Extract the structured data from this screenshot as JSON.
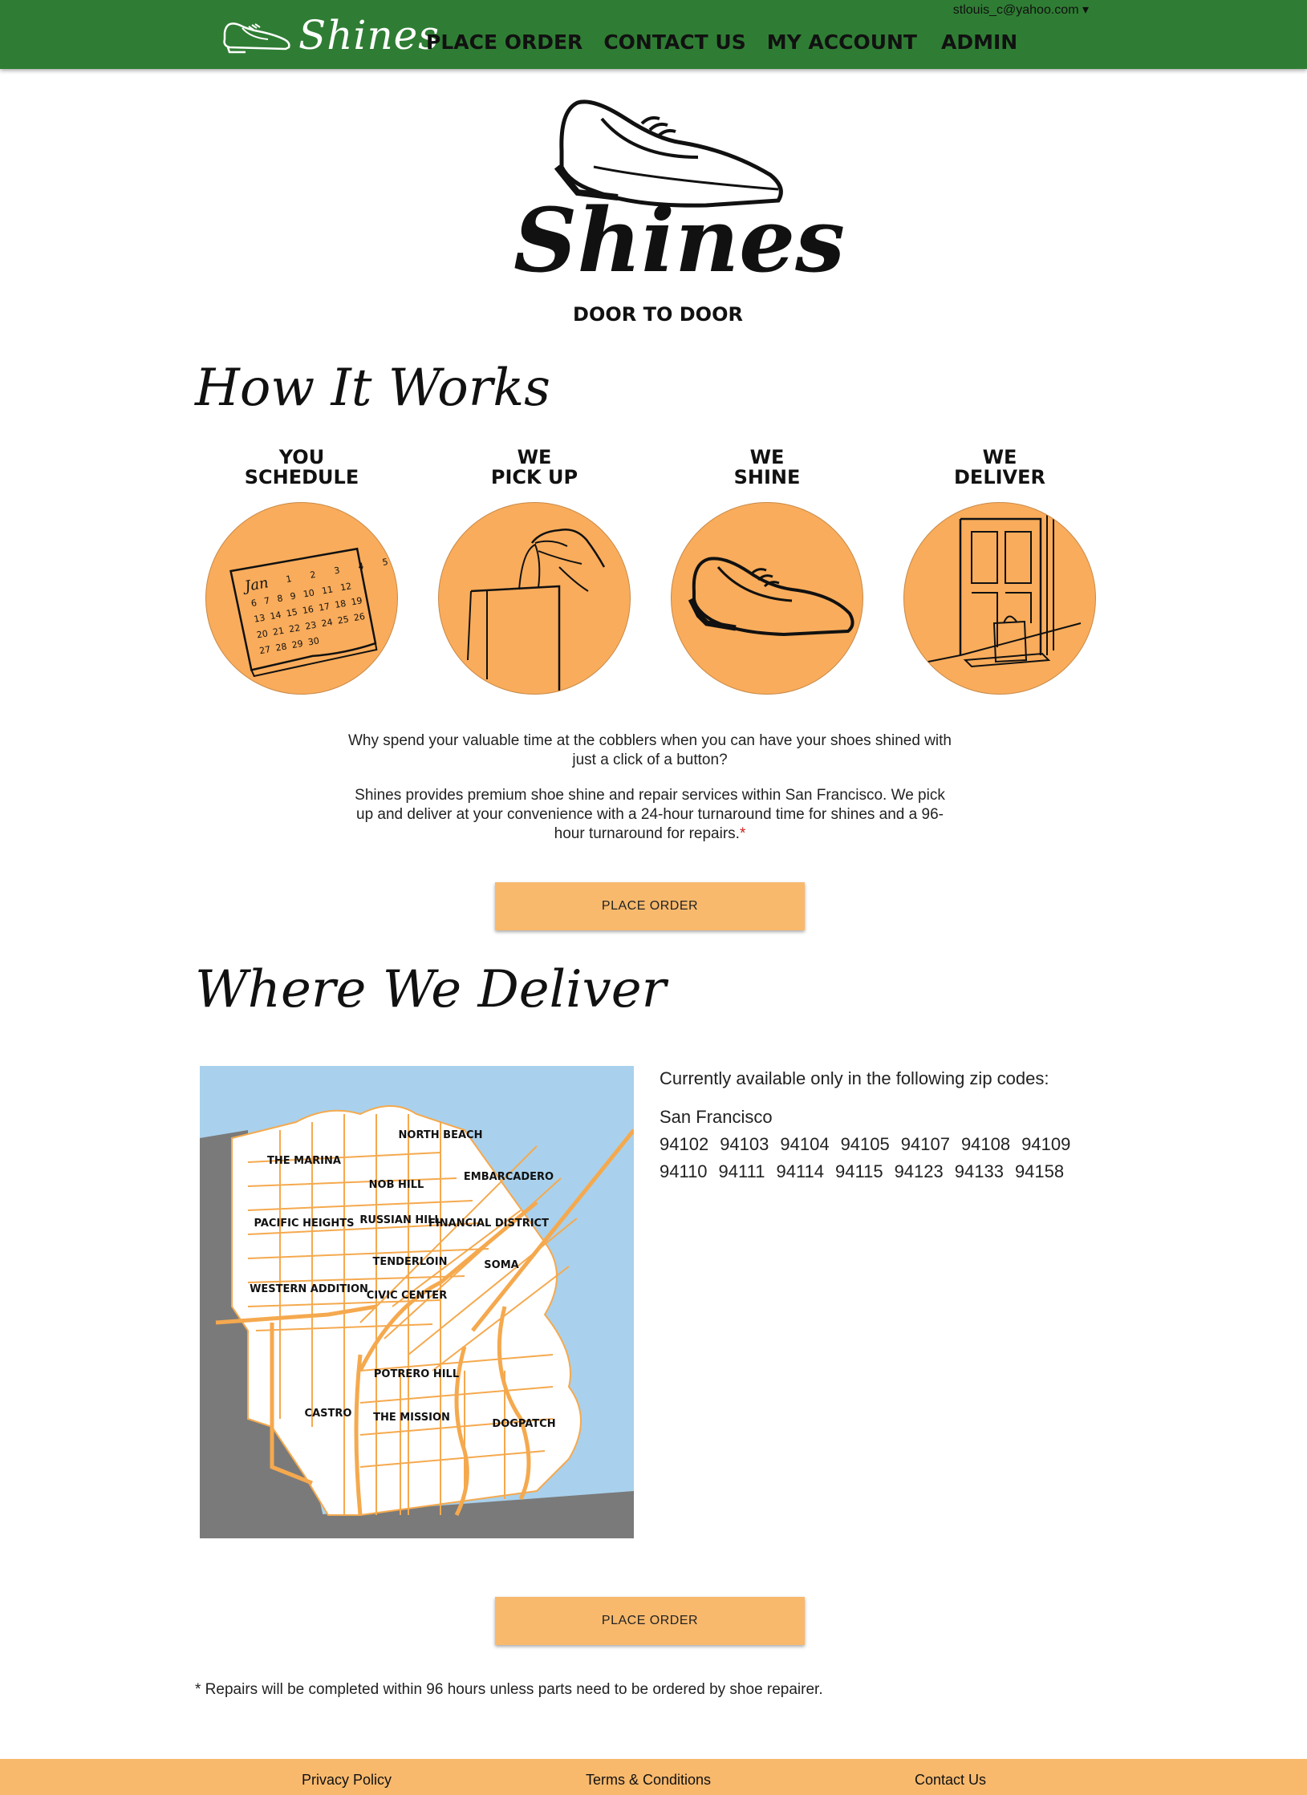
{
  "nav": {
    "brand": "Shines",
    "links": [
      "PLACE ORDER",
      "CONTACT US",
      "MY ACCOUNT",
      "ADMIN"
    ],
    "user": "stlouis_c@yahoo.com ▾"
  },
  "hero": {
    "title": "Shines",
    "subtitle": "DOOR TO DOOR"
  },
  "how_it_works": {
    "heading": "How It Works",
    "steps": [
      {
        "line1": "YOU",
        "line2": "SCHEDULE",
        "icon": "calendar-icon"
      },
      {
        "line1": "WE",
        "line2": "PICK UP",
        "icon": "hand-bag-icon"
      },
      {
        "line1": "WE",
        "line2": "SHINE",
        "icon": "shoe-icon"
      },
      {
        "line1": "WE",
        "line2": "DELIVER",
        "icon": "door-icon"
      }
    ],
    "calendar": {
      "month": "Jan",
      "rows": [
        [
          "1",
          "2",
          "3",
          "4",
          "5"
        ],
        [
          "6",
          "7",
          "8",
          "9",
          "10",
          "11",
          "12"
        ],
        [
          "13",
          "14",
          "15",
          "16",
          "17",
          "18",
          "19"
        ],
        [
          "20",
          "21",
          "22",
          "23",
          "24",
          "25",
          "26"
        ],
        [
          "27",
          "28",
          "29",
          "30"
        ]
      ]
    },
    "paragraph1": "Why spend your valuable time at the cobblers when you can have your shoes shined with just a click of a button?",
    "paragraph2": "Shines provides premium shoe shine and repair services within San Francisco. We pick up and deliver at your convenience with a 24-hour turnaround time for shines and a 96-hour turnaround for repairs.",
    "paragraph2_star": "*",
    "button": "PLACE ORDER"
  },
  "where_we_deliver": {
    "heading": "Where We Deliver",
    "intro": "Currently available only in the following zip codes:",
    "city": "San Francisco",
    "zip_rows": [
      [
        "94102",
        "94103",
        "94104",
        "94105",
        "94107",
        "94108",
        "94109"
      ],
      [
        "94110",
        "94111",
        "94114",
        "94115",
        "94123",
        "94133",
        "94158"
      ]
    ],
    "neighborhoods": [
      "NORTH BEACH",
      "THE MARINA",
      "NOB HILL",
      "EMBARCADERO",
      "PACIFIC HEIGHTS",
      "RUSSIAN HILL",
      "FINANCIAL DISTRICT",
      "TENDERLOIN",
      "SOMA",
      "WESTERN ADDITION",
      "CIVIC CENTER",
      "POTRERO HILL",
      "CASTRO",
      "THE MISSION",
      "DOGPATCH"
    ],
    "button": "PLACE ORDER"
  },
  "footnote": "* Repairs will be completed within 96 hours unless parts need to be ordered by shoe repairer.",
  "footer": {
    "links": [
      "Privacy Policy",
      "Terms & Conditions",
      "Contact Us"
    ]
  },
  "colors": {
    "nav_green": "#2f7d34",
    "accent_orange": "#f9ac5b",
    "button_orange": "#f8b96d",
    "map_water": "#a9d1ed",
    "map_land_outside": "#7a7a7a",
    "map_roads": "#f5a94e"
  }
}
